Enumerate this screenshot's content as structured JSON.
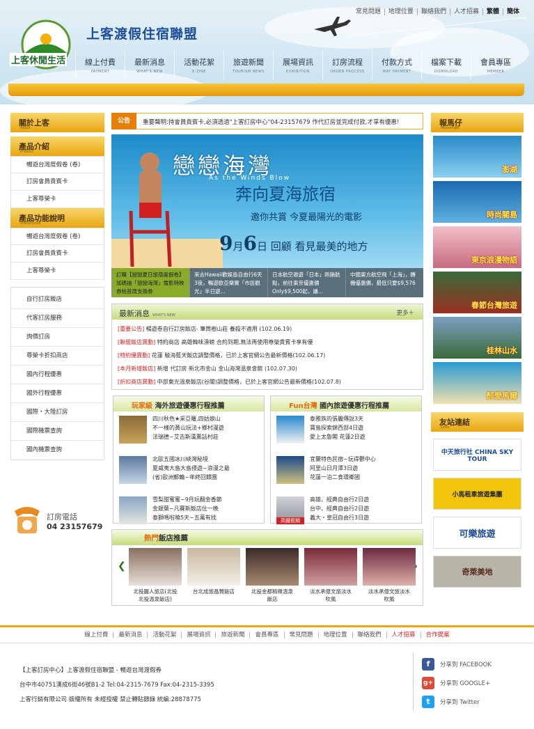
{
  "header": {
    "top_links": [
      "常見問題",
      "地理位置",
      "聯絡我們",
      "人才招募",
      "繁體",
      "簡体"
    ],
    "logo_text": "上客休閒生活",
    "site_name": "上客渡假住宿聯盟",
    "nav": [
      {
        "zh": "線上付費",
        "en": "PAYMENT"
      },
      {
        "zh": "最新消息",
        "en": "WHAT'S NEW"
      },
      {
        "zh": "活動花絮",
        "en": "E-ZINE"
      },
      {
        "zh": "旅遊新聞",
        "en": "TOURISM NEWS"
      },
      {
        "zh": "展場資訊",
        "en": "EXHIBITION"
      },
      {
        "zh": "訂房流程",
        "en": "ORDER PROCESS"
      },
      {
        "zh": "付款方式",
        "en": "WAY PAYMENT"
      },
      {
        "zh": "檔案下載",
        "en": "DOWNLOAD"
      },
      {
        "zh": "會員專區",
        "en": "MEMBER"
      }
    ]
  },
  "left": {
    "about": {
      "zh": "關於上客",
      "en": "About"
    },
    "products": {
      "zh": "產品介紹",
      "en": "Product"
    },
    "product_items": [
      "暢遊台灣度假卷 (卷)",
      "訂房會員貴賓卡",
      "上客尊榮卡"
    ],
    "instructions": {
      "zh": "產品功能說明",
      "en": "Instructions"
    },
    "instruction_items": [
      "暢遊台灣度假卷 (卷)",
      "訂房會員貴賓卡",
      "上客尊榮卡"
    ],
    "service_items": [
      "自行訂房飯店",
      "代客訂房服務",
      "詢價訂房",
      "尊榮卡折扣商店",
      "國內行程優惠",
      "國外行程優惠",
      "國際・大陸訂房",
      "國際機票查詢",
      "國內機票查詢"
    ],
    "phone_label": "訂房電話",
    "phone": "04 23157679"
  },
  "notice": {
    "tag": "公告",
    "text": "重要聲明:持會員貴賓卡,必須透過\"上客訂房中心\"04-23157679 作代訂房並完成付款,才享有優惠!"
  },
  "banner": {
    "title": "戀戀海灣",
    "subtitle": "As the Winds Blow",
    "title2": "奔向夏海旅宿",
    "slogan": "邀你共賞 今夏最陽光的電影",
    "date_month": "9",
    "date_mid": "月",
    "date_day": "6",
    "date_tail": "日  回顧  看見最美的地方",
    "thumbs": [
      "訂購【戀戀夏日旅宿度假卷】加碼抽「戀戀海灣」電影特映券給首周支換券",
      "來去Hawaii歡娛島自由行6天3夜，暢遊歐亞樂實「市區觀光」半日遊...",
      "日本航空邀遊「日本」熱銷航點，前往東京優惠價Only$9,500起，讓...",
      "中國東方航空飛「上海」，轉機優惠價，最低只要$9,576"
    ]
  },
  "news": {
    "title": "最新消息",
    "title_en": "WHAT'S NEW",
    "more": "更多＋",
    "items": [
      {
        "cat": "[重要公告]",
        "text": "暢遊卷自行訂房飯店- 筆筒樹山莊 養殺不適用 (102.06.19)"
      },
      {
        "cat": "[聯盟飯店異動]",
        "text": "特約商店 高雄韓味濤螃 合約到期,無法再使用尊榮貴賓卡享有優"
      },
      {
        "cat": "[特約優異動]",
        "text": "花蓮 駿海藍天飯店調整價格，已於上客官網公告最新價格(102.06.17)"
      },
      {
        "cat": "[本月新增飯店]",
        "text": "新增 代訂房 新北市金山  金山海灣溫泉會館  (102.07.30)"
      },
      {
        "cat": "[折扣商店異動]",
        "text": "中部東光溫泉飯店(谷關)調整價格，已於上客官網公告最新價格(102.07.8)"
      }
    ]
  },
  "promo_abroad": {
    "title_a": "玩家級",
    "title_b": "海外旅遊優惠行程推薦",
    "rows": [
      [
        "四川秋色★采亞羅.四姑娘山",
        "不一樣的黃山玩法+鄉村漫遊",
        "法瑞德~艾古斯漢薰話村莊"
      ],
      [
        "北歐五國冰川峽灣秘境",
        "夏威夷大島大島侵遊~浪漫之最",
        "(省)歐洲郵輪~年終回饋團"
      ],
      [
        "雪梨甜蜜蜜~9月玩翻金香節",
        "金銀葉~凡賽斯飯店住一晚",
        "泰獅嗎啦曉5天~五萬有找"
      ]
    ]
  },
  "promo_domestic": {
    "title_a": "Fun台灣",
    "title_b": "國內旅遊優惠行程推薦",
    "rows": [
      [
        "泰雅族的張麗傳說3天",
        "寶島探索錦西部4日遊",
        "愛上太魯閣 花蓮2日遊"
      ],
      [
        "宜蘭特色民宿~玩得鬱中心",
        "阿里山日月潭3日遊",
        "花蓮一泊二食環鄉國"
      ],
      [
        "高雄、經典自由行2日遊",
        "台中、經典自由行2日遊",
        "義大・皇冠自由行3日遊"
      ]
    ],
    "rail_label": "高鐵假期"
  },
  "hotels": {
    "title_a": "熱門",
    "title_b": "飯店推薦",
    "items": [
      [
        "北投麗人旅店(北投",
        "北投溫泉飯店)"
      ],
      [
        "台北成旅晶贊飯店",
        ""
      ],
      [
        "北投金都精緻溫泉",
        "飯店"
      ],
      [
        "淡水承億文旅淡水",
        "吹風"
      ],
      [
        "淡水承億文旅淡水",
        "吹風"
      ]
    ]
  },
  "right": {
    "messenger": {
      "zh": "報馬仔",
      "en": "Messenger"
    },
    "ads": [
      "澎湖",
      "時尚關島",
      "東京浪漫物語",
      "春節台灣旅遊",
      "桂林山水",
      "醉愛馬爾"
    ],
    "links_head": {
      "zh": "友站連結",
      "en": "Links"
    },
    "links": [
      "中天旅行社 CHINA SKY TOUR",
      "小馬租車旅遊集團",
      "可樂旅遊",
      "奇萊美地"
    ]
  },
  "footer": {
    "nav": [
      "線上付費",
      "最新消息",
      "活動花絮",
      "展場資訊",
      "旅遊新聞",
      "會員專區",
      "常見問題",
      "地理位置",
      "聯絡我們",
      "人才招募",
      "合作提案"
    ],
    "line1": "【上客訂房中心】上客渡假住宿聯盟 - 暢遊台灣渡假券",
    "line2": "台中市40751漢成6街46號B1-2   Tel:04-2315-7679  Fax:04-2315-3395",
    "line3": "上客行銷有限公司 版權所有 未經授權 禁止轉貼節錄  統編:28878775",
    "social": [
      "分享到 FACEBOOK",
      "分享到 GOOGLE+",
      "分享到 Twitter"
    ]
  },
  "colors": {
    "accent": "#e9a611",
    "green": "#7aa62a",
    "red": "#d42020"
  }
}
